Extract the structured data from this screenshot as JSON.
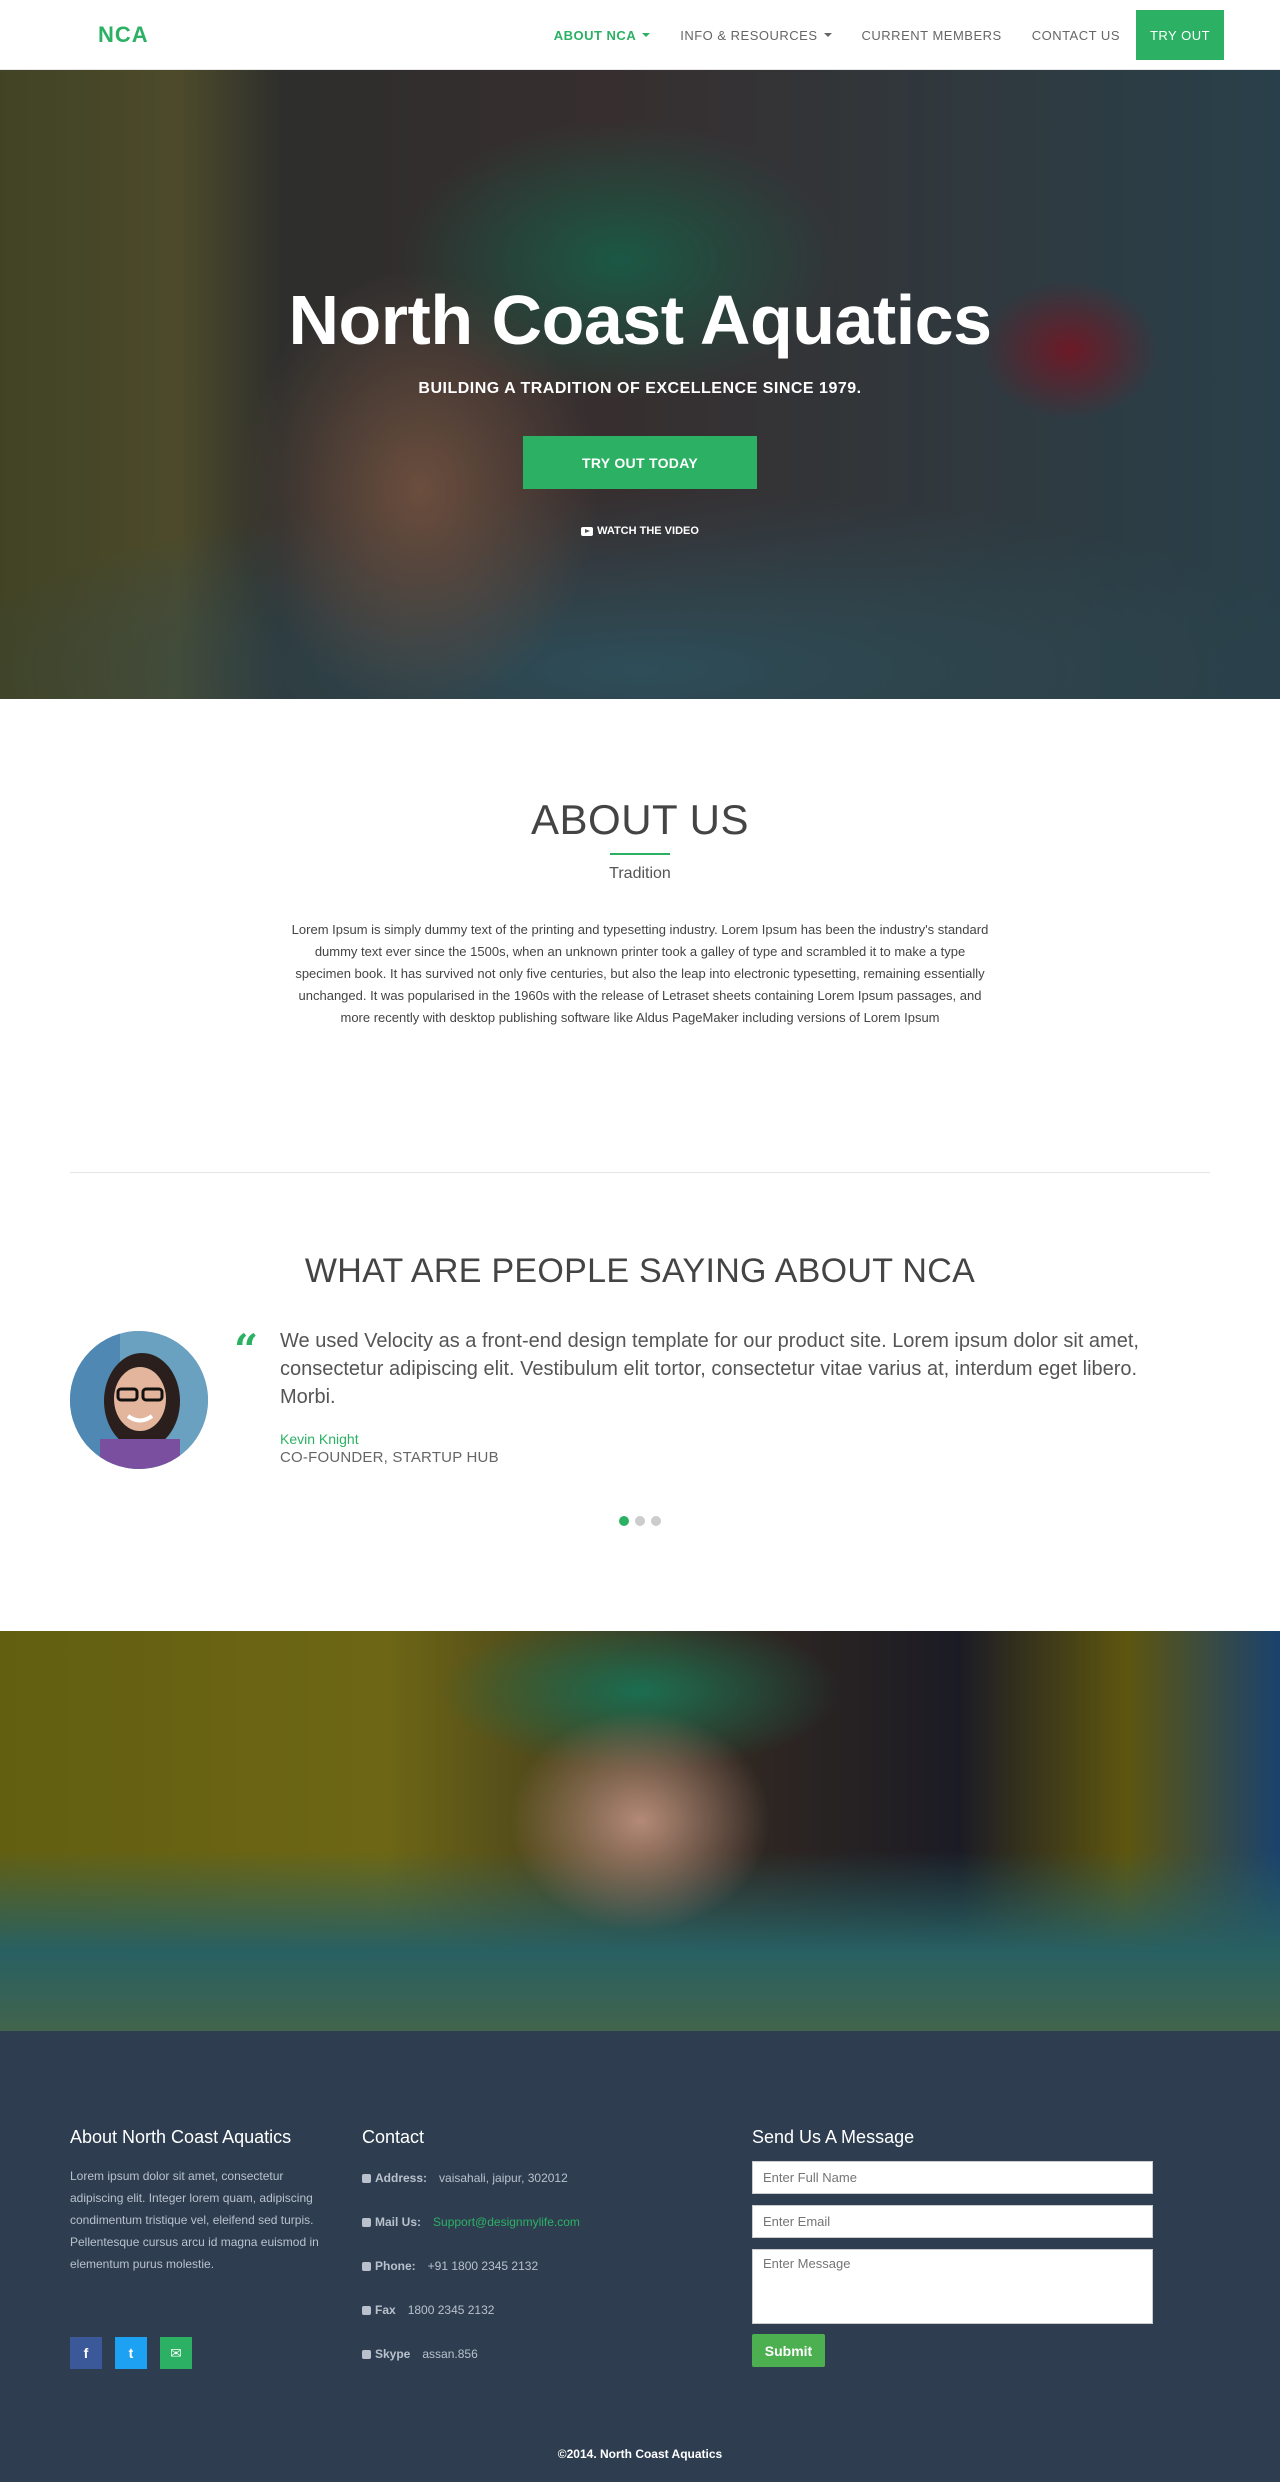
{
  "nav": {
    "brand": "NCA",
    "items": [
      {
        "label": "ABOUT NCA",
        "active": true,
        "dropdown": true
      },
      {
        "label": "INFO & RESOURCES",
        "active": false,
        "dropdown": true
      },
      {
        "label": "CURRENT MEMBERS",
        "active": false,
        "dropdown": false
      },
      {
        "label": "CONTACT US",
        "active": false,
        "dropdown": false
      }
    ],
    "cta": "TRY OUT"
  },
  "hero": {
    "title": "North Coast Aquatics",
    "subtitle": "BUILDING A TRADITION OF EXCELLENCE SINCE 1979.",
    "button": "TRY OUT TODAY",
    "video_link": "WATCH THE VIDEO",
    "video_icon": "youtube-play-icon"
  },
  "about": {
    "title": "ABOUT US",
    "subtitle": "Tradition",
    "text": "Lorem Ipsum is simply dummy text of the printing and typesetting industry. Lorem Ipsum has been the industry's standard dummy text ever since the 1500s, when an unknown printer took a galley of type and scrambled it to make a type specimen book. It has survived not only five centuries, but also the leap into electronic typesetting, remaining essentially unchanged. It was popularised in the 1960s with the release of Letraset sheets containing Lorem Ipsum passages, and more recently with desktop publishing software like Aldus PageMaker including versions of Lorem Ipsum"
  },
  "testimonials": {
    "title": "WHAT ARE PEOPLE SAYING ABOUT NCA",
    "quote": "We used Velocity as a front-end design template for our product site. Lorem ipsum dolor sit amet, consectetur adipiscing elit. Vestibulum elit tortor, consectetur vitae varius at, interdum eget libero. Morbi.",
    "author": "Kevin Knight",
    "role": "CO-FOUNDER, STARTUP HUB",
    "quote_icon": "quote-left-icon",
    "slides": 3,
    "active_slide": 1
  },
  "footer": {
    "about_title": "About North Coast Aquatics",
    "about_text": "Lorem ipsum dolor sit amet, consectetur adipiscing elit. Integer lorem quam, adipiscing condimentum tristique vel, eleifend sed turpis. Pellentesque cursus arcu id magna euismod in elementum purus molestie.",
    "social": [
      {
        "icon": "facebook-icon",
        "glyph": "f"
      },
      {
        "icon": "twitter-icon",
        "glyph": "t"
      },
      {
        "icon": "envelope-icon",
        "glyph": "✉"
      }
    ],
    "contact_title": "Contact",
    "contact": [
      {
        "icon": "map-marker-icon",
        "label": "Address:",
        "value": "vaisahali, jaipur, 302012"
      },
      {
        "icon": "envelope-icon",
        "label": "Mail Us:",
        "value": "Support@designmylife.com"
      },
      {
        "icon": "phone-icon",
        "label": "Phone:",
        "value": "+91 1800 2345 2132"
      },
      {
        "icon": "fax-icon",
        "label": "Fax",
        "value": "1800 2345 2132"
      },
      {
        "icon": "skype-icon",
        "label": "Skype",
        "value": "assan.856"
      }
    ],
    "form_title": "Send Us A Message",
    "form": {
      "name_placeholder": "Enter Full Name",
      "email_placeholder": "Enter Email",
      "message_placeholder": "Enter Message",
      "submit": "Submit"
    },
    "copyright": "©2014. North Coast Aquatics"
  },
  "colors": {
    "accent": "#2cb164",
    "footer_bg": "#2e3e50"
  }
}
